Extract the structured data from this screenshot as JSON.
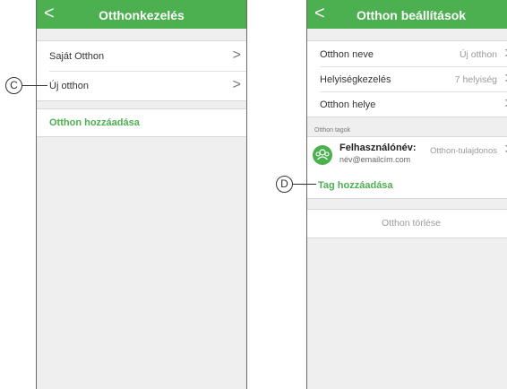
{
  "screen1": {
    "title": "Otthonkezelés",
    "back_glyph": "<",
    "homes": [
      {
        "label": "Saját Otthon",
        "chevron": ">"
      },
      {
        "label": "Új otthon",
        "chevron": ">"
      }
    ],
    "add_home": "Otthon hozzáadása"
  },
  "screen2": {
    "title": "Otthon beállítások",
    "back_glyph": "<",
    "settings": [
      {
        "label": "Otthon neve",
        "value": "Új otthon",
        "chevron": ">"
      },
      {
        "label": "Helyiségkezelés",
        "value": "7 helyiség",
        "chevron": ">"
      },
      {
        "label": "Otthon helye",
        "value": "",
        "chevron": ">"
      }
    ],
    "members_section": "Otthon tagok",
    "member": {
      "name": "Felhasználónév:",
      "email": "név@emailcím.com",
      "role": "Otthon-tulajdonos",
      "chevron": ">"
    },
    "add_member": "Tag hozzáadása",
    "delete_home": "Otthon törlése"
  },
  "callouts": {
    "c": "C",
    "d": "D"
  },
  "colors": {
    "accent": "#4caf50",
    "background": "#efefef"
  },
  "icons": {
    "back": "chevron-left-icon",
    "row": "chevron-right-icon",
    "avatar": "users-group-icon"
  }
}
